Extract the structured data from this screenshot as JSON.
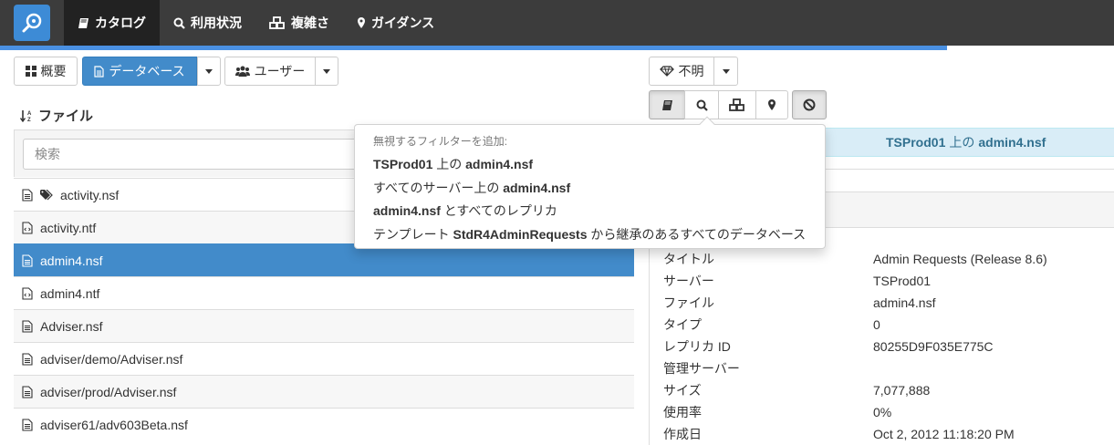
{
  "nav": {
    "items": [
      {
        "label": "カタログ",
        "icon": "book-icon"
      },
      {
        "label": "利用状況",
        "icon": "search-icon"
      },
      {
        "label": "複雑さ",
        "icon": "cubes-icon"
      },
      {
        "label": "ガイダンス",
        "icon": "map-marker-icon"
      }
    ],
    "progress": 0.85
  },
  "toolbar": {
    "overview_label": "概要",
    "database_label": "データベース",
    "user_label": "ユーザー",
    "unknown_label": "不明"
  },
  "files": {
    "header": "ファイル",
    "search_placeholder": "検索",
    "rows": [
      {
        "name": "activity.nsf",
        "icon": "file-text-icon",
        "tag": true
      },
      {
        "name": "activity.ntf",
        "icon": "file-code-icon"
      },
      {
        "name": "admin4.nsf",
        "icon": "file-text-icon",
        "selected": true
      },
      {
        "name": "admin4.ntf",
        "icon": "file-code-icon"
      },
      {
        "name": "Adviser.nsf",
        "icon": "file-text-icon"
      },
      {
        "name": "adviser/demo/Adviser.nsf",
        "icon": "file-text-icon"
      },
      {
        "name": "adviser/prod/Adviser.nsf",
        "icon": "file-text-icon"
      },
      {
        "name": "adviser61/adv603Beta.nsf",
        "icon": "file-text-icon"
      }
    ]
  },
  "banner": {
    "server": "TSProd01",
    "on": "上の",
    "file": "admin4.nsf"
  },
  "properties": [
    {
      "key": "タイトル",
      "value": "Admin Requests (Release 8.6)"
    },
    {
      "key": "サーバー",
      "value": "TSProd01"
    },
    {
      "key": "ファイル",
      "value": "admin4.nsf"
    },
    {
      "key": "タイプ",
      "value": "0"
    },
    {
      "key": "レプリカ ID",
      "value": "80255D9F035E775C"
    },
    {
      "key": "管理サーバー",
      "value": ""
    },
    {
      "key": "サイズ",
      "value": "7,077,888"
    },
    {
      "key": "使用率",
      "value": "0%"
    },
    {
      "key": "作成日",
      "value": "Oct 2, 2012 11:18:20 PM"
    }
  ],
  "menu": {
    "header": "無視するフィルターを追加:",
    "item1": {
      "b1": "TSProd01",
      "t1": " 上の ",
      "b2": "admin4.nsf"
    },
    "item2": {
      "t1": "すべてのサーバー上の ",
      "b1": "admin4.nsf"
    },
    "item3": {
      "b1": "admin4.nsf",
      "t1": " とすべてのレプリカ"
    },
    "item4": {
      "t1": "テンプレート ",
      "b1": "StdR4AdminRequests",
      "t2": " から継承のあるすべてのデータベース"
    }
  }
}
